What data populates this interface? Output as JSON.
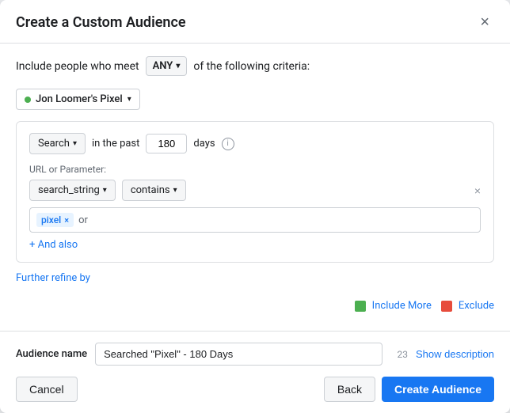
{
  "modal": {
    "title": "Create a Custom Audience",
    "close_label": "×"
  },
  "include_row": {
    "prefix": "Include people who meet",
    "any_label": "ANY",
    "suffix": "of the following criteria:"
  },
  "pixel": {
    "name": "Jon Loomer's Pixel",
    "chevron": "▾"
  },
  "criteria": {
    "search_label": "Search",
    "in_the_past": "in the past",
    "days_value": "180",
    "days_label": "days",
    "url_label": "URL or Parameter:",
    "filter_field": "search_string",
    "filter_op": "contains",
    "tag_value": "pixel",
    "or_label": "or",
    "and_also": "+ And also"
  },
  "further_refine": "Further refine by",
  "actions": {
    "include_more": "Include More",
    "exclude": "Exclude"
  },
  "footer": {
    "audience_name_label": "Audience name",
    "audience_name_value": "Searched \"Pixel\" - 180 Days",
    "char_count": "23",
    "show_description": "Show description",
    "cancel": "Cancel",
    "back": "Back",
    "create": "Create Audience"
  }
}
